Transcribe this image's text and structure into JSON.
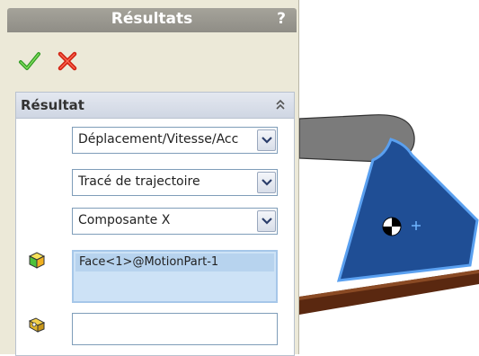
{
  "panel": {
    "title": "Résultats",
    "help_label": "?",
    "ok_icon": "green-check-icon",
    "cancel_icon": "red-x-icon"
  },
  "section": {
    "title": "Résultat",
    "collapse_icon": "double-chevron-up-icon",
    "dropdowns": [
      {
        "selected": "Déplacement/Vitesse/Acc"
      },
      {
        "selected": "Tracé de trajectoire"
      },
      {
        "selected": "Composante X"
      }
    ],
    "selection_list": {
      "icon": "face-selection-cube-icon",
      "items": [
        "Face<1>@MotionPart-1"
      ]
    },
    "reference_field": {
      "icon": "reference-part-icon",
      "value": ""
    }
  },
  "colors": {
    "title_bar": "#9a988f",
    "panel_bg": "#ece9d8",
    "selection_bg": "#cde2f6",
    "selected_part": "#1f4e95",
    "part_edge": "#4a90e2",
    "beam": "#5a2810"
  }
}
